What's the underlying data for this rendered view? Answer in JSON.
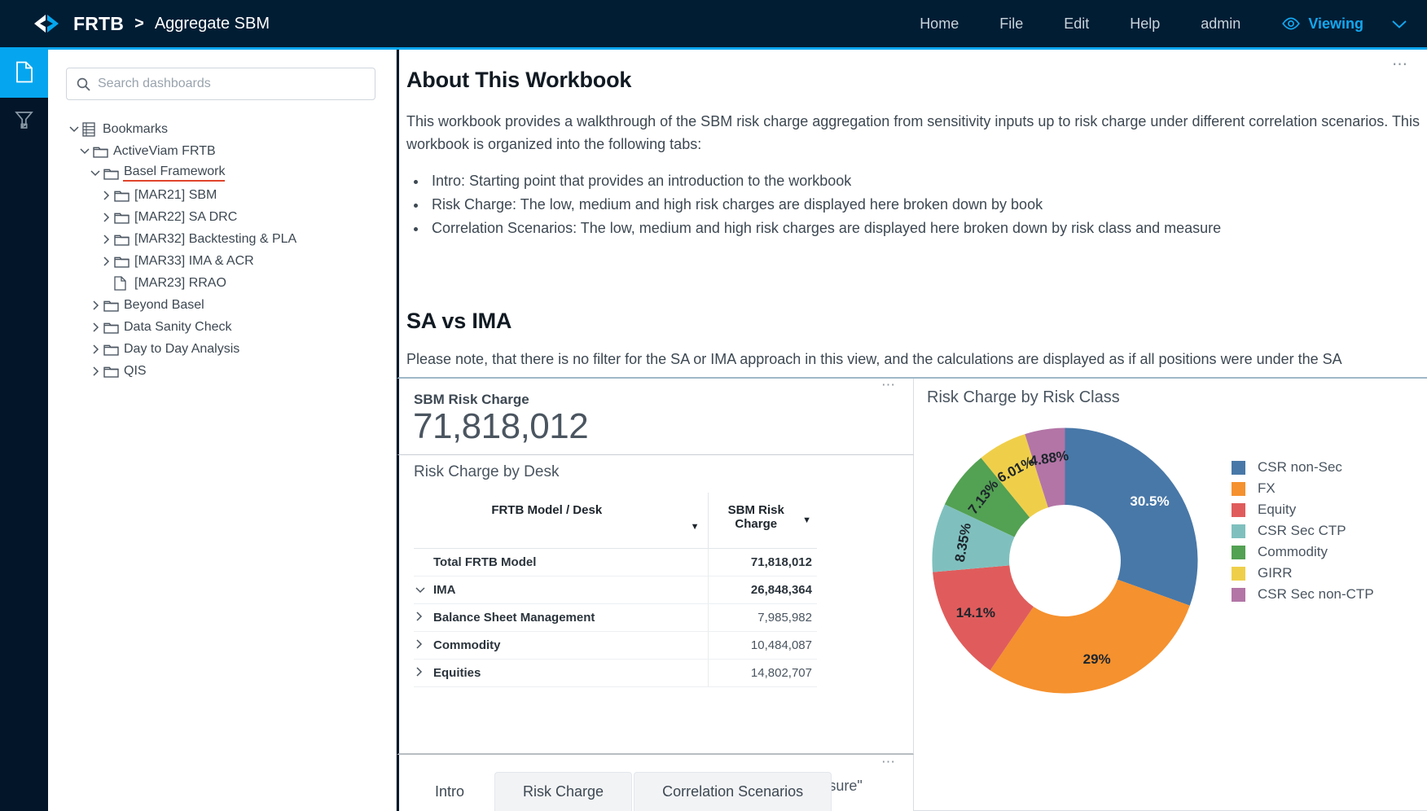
{
  "topbar": {
    "logo_icon": "activeviam-logo-icon",
    "brand": "FRTB",
    "separator": ">",
    "subtitle": "Aggregate SBM",
    "nav": [
      {
        "label": "Home"
      },
      {
        "label": "File"
      },
      {
        "label": "Edit"
      },
      {
        "label": "Help"
      },
      {
        "label": "admin"
      }
    ],
    "viewing": {
      "icon": "eye-icon",
      "label": "Viewing",
      "caret_icon": "chevron-down-icon"
    },
    "accent_color": "#05a6ef",
    "background_color": "#011d34"
  },
  "rail": {
    "items": [
      {
        "name": "dashboards",
        "icon": "file-icon",
        "active": true
      },
      {
        "name": "filters",
        "icon": "funnel-icon",
        "active": false
      }
    ]
  },
  "sidebar": {
    "search": {
      "placeholder": "Search dashboards",
      "value": "",
      "icon": "search-icon"
    },
    "tree": [
      {
        "depth": 0,
        "chevron": "down",
        "icon": "bookmarks-icon",
        "label": "Bookmarks",
        "selected": false
      },
      {
        "depth": 1,
        "chevron": "down",
        "icon": "folder-icon",
        "label": "ActiveViam FRTB",
        "selected": false
      },
      {
        "depth": 2,
        "chevron": "down",
        "icon": "folder-icon",
        "label": "Basel Framework",
        "selected": true
      },
      {
        "depth": 3,
        "chevron": "right",
        "icon": "folder-icon",
        "label": "[MAR21] SBM",
        "selected": false
      },
      {
        "depth": 3,
        "chevron": "right",
        "icon": "folder-icon",
        "label": "[MAR22] SA DRC",
        "selected": false
      },
      {
        "depth": 3,
        "chevron": "right",
        "icon": "folder-icon",
        "label": "[MAR32] Backtesting & PLA",
        "selected": false
      },
      {
        "depth": 3,
        "chevron": "right",
        "icon": "folder-icon",
        "label": "[MAR33] IMA & ACR",
        "selected": false
      },
      {
        "depth": 3,
        "chevron": "none",
        "icon": "document-icon",
        "label": "[MAR23] RRAO",
        "selected": false
      },
      {
        "depth": 2,
        "chevron": "right",
        "icon": "folder-icon",
        "label": "Beyond Basel",
        "selected": false
      },
      {
        "depth": 2,
        "chevron": "right",
        "icon": "folder-icon",
        "label": "Data Sanity Check",
        "selected": false
      },
      {
        "depth": 2,
        "chevron": "right",
        "icon": "folder-icon",
        "label": "Day to Day Analysis",
        "selected": false
      },
      {
        "depth": 2,
        "chevron": "right",
        "icon": "folder-icon",
        "label": "QIS",
        "selected": false
      }
    ]
  },
  "main": {
    "overflow_menu": "⋯",
    "intro": {
      "heading": "About This Workbook",
      "paragraph": "This workbook provides a walkthrough of the SBM risk charge aggregation from sensitivity inputs up to risk charge under different correlation scenarios. This workbook is organized into the following tabs:",
      "bullets": [
        "Intro: Starting point that provides an introduction to the workbook",
        "Risk Charge: The low, medium and high risk charges are displayed here broken down by book",
        "Correlation Scenarios: The low, medium and high risk charges are displayed here broken down by risk class and measure"
      ]
    },
    "sa_vs_ima": {
      "heading": "SA vs IMA",
      "paragraph": "Please note, that there is no filter for the SA or IMA approach in this view, and the calculations are displayed as if all positions were under the SA"
    },
    "kpi": {
      "label": "SBM Risk Charge",
      "value": "71,818,012",
      "overflow_menu": "⋯"
    },
    "table_panel": {
      "title": "Risk Charge by Desk",
      "columns": [
        {
          "label": "FRTB Model / Desk",
          "sort_icon": "sort-caret-icon"
        },
        {
          "label": "SBM Risk Charge",
          "sort_icon": "sort-caret-icon"
        }
      ],
      "rows": [
        {
          "name": "Total FRTB Model",
          "value": "71,818,012",
          "level": 1,
          "chevron": "none"
        },
        {
          "name": "IMA",
          "value": "26,848,364",
          "level": 1,
          "chevron": "down"
        },
        {
          "name": "Balance Sheet Management",
          "value": "7,985,982",
          "level": 2,
          "chevron": "right"
        },
        {
          "name": "Commodity",
          "value": "10,484,087",
          "level": 2,
          "chevron": "right"
        },
        {
          "name": "Equities",
          "value": "14,802,707",
          "level": 2,
          "chevron": "right"
        }
      ]
    },
    "note_panel": {
      "text": "Note, in this view desk expansion is set to \"risk class\", \"risk measure\"",
      "overflow_menu": "⋯"
    },
    "tabs": [
      {
        "label": "Intro",
        "active": true
      },
      {
        "label": "Risk Charge",
        "active": false
      },
      {
        "label": "Correlation Scenarios",
        "active": false
      }
    ]
  },
  "chart_data": {
    "type": "pie",
    "variant": "donut",
    "title": "Risk Charge by Risk Class",
    "categories": [
      "CSR non-Sec",
      "FX",
      "Equity",
      "CSR Sec CTP",
      "Commodity",
      "GIRR",
      "CSR Sec non-CTP"
    ],
    "values": [
      30.5,
      29.0,
      14.1,
      8.35,
      7.13,
      6.01,
      4.88
    ],
    "labels": [
      "30.5%",
      "29%",
      "14.1%",
      "8.35%",
      "7.13%",
      "6.01%",
      "4.88%"
    ],
    "colors": [
      "#4878a8",
      "#f5912e",
      "#e05c5c",
      "#7fc0be",
      "#53a153",
      "#efcf4a",
      "#b375a6"
    ],
    "label_colors": [
      "#ffffff",
      "#1d252c",
      "#1d252c",
      "#1d252c",
      "#1d252c",
      "#1d252c",
      "#1d252c"
    ],
    "legend_position": "right",
    "hole_ratio": 0.42,
    "start_angle_deg": 0,
    "direction": "clockwise",
    "units": "percent"
  }
}
